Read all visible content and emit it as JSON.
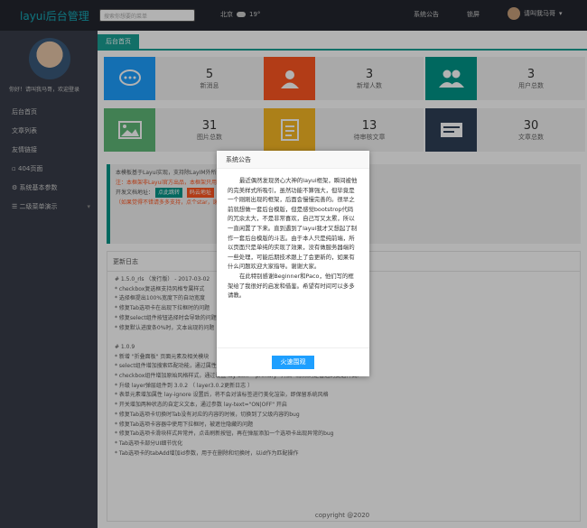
{
  "header": {
    "logo": "layui后台管理",
    "search_placeholder": "搜索你想要的菜单",
    "weather_city": "北京",
    "weather_temp": "19°",
    "nav_announce": "系统公告",
    "nav_lock": "锁屏",
    "user_name": "请叫我马哥"
  },
  "sidebar": {
    "welcome": "你好！请叫我马哥，欢迎登录",
    "items": [
      {
        "label": "后台首页"
      },
      {
        "label": "文章列表"
      },
      {
        "label": "友情链接"
      },
      {
        "label": "404页面"
      },
      {
        "label": "系统基本参数"
      },
      {
        "label": "二级菜单演示",
        "arrow": "▾"
      }
    ]
  },
  "main": {
    "tab": "后台首页",
    "stats": [
      {
        "value": "5",
        "label": "新消息",
        "color": "#1e9fff",
        "icon": "chat-icon"
      },
      {
        "value": "3",
        "label": "新增人数",
        "color": "#ff5722",
        "icon": "user-add-icon"
      },
      {
        "value": "3",
        "label": "用户总数",
        "color": "#009688",
        "icon": "users-icon"
      },
      {
        "value": "31",
        "label": "图片总数",
        "color": "#5fb878",
        "icon": "image-icon"
      },
      {
        "value": "13",
        "label": "待审核文章",
        "color": "#f7b824",
        "icon": "doc-icon"
      },
      {
        "value": "30",
        "label": "文章总数",
        "color": "#2f4056",
        "icon": "article-icon"
      }
    ],
    "notice": {
      "line1": "本模板基于Layui实现，支持除LayIM外所有Layui组件。如需使用LayIM，请先购买授权。",
      "line1b": "注：本框架非Layui官方出品，本框架只用于学习交流，切勿用于商业用途，否则后果自负",
      "line2": "开发文档地址：",
      "tag1": "点此跳转",
      "tag2": "码云地址",
      "line3": "（如果觉得不错请多多支持，点个star，谢谢）"
    },
    "update_title": "更新日志",
    "update_lines": [
      "# 1.5.0_rls （发行版） - 2017-03-02",
      "* checkbox复选框支持风格专属样式",
      "* 选择框提出100%宽度下的自动宽度",
      "* 修复Tab选项卡在出现下拉框时的问题",
      "* 修复select组件按钮选择时会导致的问题",
      "* 修复默认进度条0%时，文本出现的问题",
      "",
      "# 1.0.9",
      "* 新增 \"折叠面板\" 页面元素及相关模块",
      "* select组件增加搜索匹配功能，通过属性 lay-search 开启",
      "* checkbox组件增加原始风格样式，通过设置 lay-skin=\"primary\" 开启（原来的是普通的复选样式）",
      "* 升级 layer弹层组件到 3.0.2 （ layer3.0.2更新日志 ）",
      "* 表单元素增加属性 lay-ignore 设置后，将不会对该标签进行美化渲染，即保留系统风格",
      "* 开关增加两种状态的自定义文本，通过参数 lay-text=\"ON|OFF\" 开启",
      "* 修复Tab选项卡切换时Tab没有对应的内容的时候，切换到了父级内容的bug",
      "* 修复Tab选项卡容器中使用下拉框时，被遮住隐藏的问题",
      "* 修复Tab选项卡滑块样式异常并，点击刷新按钮，再在弹层添加一个选项卡出现异常的bug",
      "* Tab选项卡部分UI细节优化",
      "* Tab选项卡的tabAdd增加id参数，用于在删除和切换时，以id作为匹配操作"
    ],
    "footer": "copyright @2020"
  },
  "dialog": {
    "title": "系统公告",
    "para1": "最近偶然发现贤心大神的layui框架，瞬间被他的完美样式所吸引，虽然功能不算强大，但毕竟是一个刚刚出现的框架，后面会慢慢完善的。很早之前就想做一套后台模版，但是感觉bootstrop代码的冗余太大，不是非常喜欢，自己写又太累，所以一直闲置了下来。直到遇到了layui我才又想起了制作一套后台模版的斗志。由于本人只是纯前端，所以页面只是单纯的实现了效果，没有做服务器端的一些处理，可能后期技术跟上了会更新的，如果有什么问题欢迎大家指导。谢谢大家。",
    "para2": "在此特别感谢Beginner和Paco，他们写的框架给了我很好的启发和借鉴。希望有时间可以多多请教。",
    "button": "火速围观"
  }
}
